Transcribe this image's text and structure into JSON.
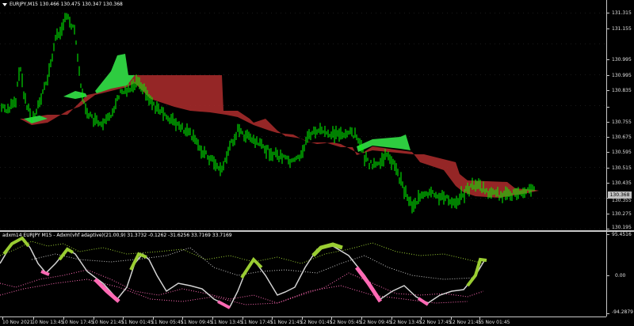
{
  "header": {
    "symbol_line": "EURJPY,M15  130.466 130.475 130.347 130.368"
  },
  "indicator": {
    "title": "adxm14 EURJPY M15 - Adxm(vhf adaptive)(21.00,9) 31.3732 -0.1262 -31.6256 33.7169 33.7169"
  },
  "price_axis": {
    "labels": [
      "131.315",
      "131.155",
      "130.995",
      "130.995",
      "130.835",
      "130.755",
      "130.675",
      "130.595",
      "130.515",
      "130.435",
      "130.355",
      "130.275",
      "130.195"
    ],
    "current_price": "130.368"
  },
  "sub_axis": {
    "labels": [
      "95.4516",
      "0.00",
      "-94.2879"
    ]
  },
  "time_axis": {
    "labels": [
      "10 Nov 2021",
      "10 Nov 13:45",
      "10 Nov 17:45",
      "10 Nov 21:45",
      "11 Nov 01:45",
      "11 Nov 05:45",
      "11 Nov 09:45",
      "11 Nov 13:45",
      "11 Nov 17:45",
      "11 Nov 21:45",
      "12 Nov 01:45",
      "12 Nov 05:45",
      "12 Nov 09:45",
      "12 Nov 13:45",
      "12 Nov 17:45",
      "12 Nov 21:45",
      "15 Nov 01:45"
    ]
  },
  "colors": {
    "background": "#000000",
    "bull_bar": "#00ff00",
    "cloud_bull": "#32cd32",
    "cloud_bear": "#b22222",
    "adx_up": "#9acd32",
    "adx_down": "#ff69b4",
    "adx_line": "#d3d3d3"
  }
}
